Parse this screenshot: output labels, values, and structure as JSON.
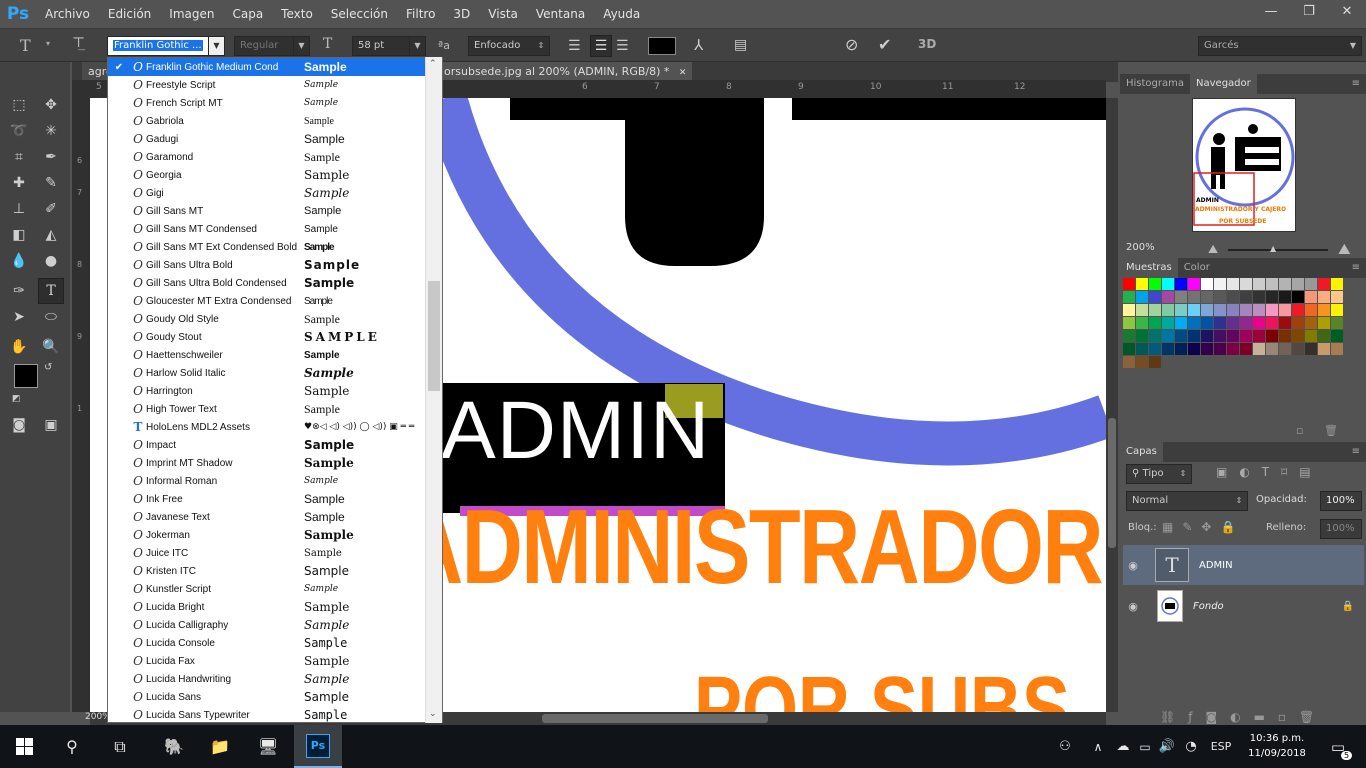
{
  "app": {
    "logo": "Ps"
  },
  "menu": [
    "Archivo",
    "Edición",
    "Imagen",
    "Capa",
    "Texto",
    "Selección",
    "Filtro",
    "3D",
    "Vista",
    "Ventana",
    "Ayuda"
  ],
  "window_controls": {
    "minimize": "—",
    "restore": "❐",
    "close": "✕"
  },
  "options": {
    "font_family": "Franklin Gothic ...",
    "font_style": "Regular",
    "font_size": "58 pt",
    "aa_label": "a",
    "antialias": "Enfocado",
    "three_d": "3D",
    "workspace": "Garcés"
  },
  "document_tabs": [
    {
      "label": "agre"
    },
    {
      "label": "orsubsede.jpg al 200% (ADMIN, RGB/8) *",
      "close": "✕"
    }
  ],
  "ruler_top_ticks": [
    "5",
    "6",
    "7",
    "8",
    "9",
    "10",
    "11",
    "12"
  ],
  "ruler_left_ticks": [
    "6",
    "7",
    "8",
    "9",
    "1"
  ],
  "canvas_text": {
    "admin": "ADMIN",
    "administrador": "ADMINISTRADOR",
    "por_subs": "POR SUBS"
  },
  "status": {
    "zoom": "200%"
  },
  "navigator": {
    "tabs": [
      "Histograma",
      "Navegador"
    ],
    "active_tab": "Navegador",
    "zoom": "200%",
    "thumb_admin": "ADMIN",
    "thumb_line1": "ADMINISTRADOR Y CAJERO",
    "thumb_line2": "POR SUBSEDE"
  },
  "swatches_panel": {
    "tabs": [
      "Muestras",
      "Color"
    ],
    "active_tab": "Muestras",
    "colors": [
      "#ff0000",
      "#ffff00",
      "#00ff00",
      "#00ffff",
      "#0000ff",
      "#ff00ff",
      "#ffffff",
      "#f2f2f2",
      "#e6e6e6",
      "#d9d9d9",
      "#cccccc",
      "#bfbfbf",
      "#b3b3b3",
      "#a6a6a6",
      "#999999",
      "#ed1c24",
      "#fff200",
      "#22b14c",
      "#00a2e8",
      "#3f48cc",
      "#a349a4",
      "#808080",
      "#737373",
      "#666666",
      "#595959",
      "#4d4d4d",
      "#404040",
      "#333333",
      "#262626",
      "#1a1a1a",
      "#000000",
      "#f7977a",
      "#fbad82",
      "#fdc68a",
      "#fff79a",
      "#c4df9b",
      "#a2d39c",
      "#82ca9d",
      "#7bcdc8",
      "#6ecff6",
      "#7ea7d8",
      "#8493ca",
      "#8882be",
      "#a187be",
      "#bc8dbf",
      "#f49ac2",
      "#f6989d",
      "#ed1c24",
      "#f26522",
      "#f7941d",
      "#fff200",
      "#8dc73f",
      "#39b54a",
      "#00a651",
      "#00a99d",
      "#00aeef",
      "#0072bc",
      "#0054a6",
      "#2e3192",
      "#662d91",
      "#92278f",
      "#ec008c",
      "#ed145b",
      "#9e0b0f",
      "#a0410d",
      "#a3620a",
      "#aba000",
      "#598527",
      "#1a7b30",
      "#007236",
      "#00746b",
      "#0076a3",
      "#004b80",
      "#003471",
      "#1b1464",
      "#440e62",
      "#630460",
      "#9e005d",
      "#9e0039",
      "#790000",
      "#7b2e00",
      "#7d4900",
      "#827b00",
      "#406618",
      "#005e20",
      "#005826",
      "#005952",
      "#005b7f",
      "#003663",
      "#002157",
      "#0d004c",
      "#32004b",
      "#4b0049",
      "#7b0046",
      "#7a0026",
      "#c7b299",
      "#998675",
      "#736357",
      "#534741",
      "#37302a",
      "#c69c6d",
      "#a67c52",
      "#8c6239",
      "#754c24",
      "#603913"
    ]
  },
  "layers_panel": {
    "tab": "Capas",
    "filter": "Tipo",
    "blend": "Normal",
    "opacity_label": "Opacidad:",
    "opacity": "100%",
    "lock_label": "Bloq.:",
    "fill_label": "Relleno:",
    "fill": "100%",
    "layers": [
      {
        "name": "ADMIN",
        "thumb": "T"
      },
      {
        "name": "Fondo",
        "thumb": ""
      }
    ]
  },
  "font_list": [
    {
      "name": "Franklin Gothic Medium Cond",
      "sample": "Sample",
      "selected": true
    },
    {
      "name": "Freestyle Script",
      "sample": "Sample"
    },
    {
      "name": "French Script MT",
      "sample": "Sample"
    },
    {
      "name": "Gabriola",
      "sample": "Sample"
    },
    {
      "name": "Gadugi",
      "sample": "Sample"
    },
    {
      "name": "Garamond",
      "sample": "Sample"
    },
    {
      "name": "Georgia",
      "sample": "Sample"
    },
    {
      "name": "Gigi",
      "sample": "Sample"
    },
    {
      "name": "Gill Sans MT",
      "sample": "Sample"
    },
    {
      "name": "Gill Sans MT Condensed",
      "sample": "Sample"
    },
    {
      "name": "Gill Sans MT Ext Condensed Bold",
      "sample": "Sample"
    },
    {
      "name": "Gill Sans Ultra Bold",
      "sample": "Sample"
    },
    {
      "name": "Gill Sans Ultra Bold Condensed",
      "sample": "Sample"
    },
    {
      "name": "Gloucester MT Extra Condensed",
      "sample": "Sample"
    },
    {
      "name": "Goudy Old Style",
      "sample": "Sample"
    },
    {
      "name": "Goudy Stout",
      "sample": "SAMPLE"
    },
    {
      "name": "Haettenschweiler",
      "sample": "Sample"
    },
    {
      "name": "Harlow Solid Italic",
      "sample": "Sample"
    },
    {
      "name": "Harrington",
      "sample": "Sample"
    },
    {
      "name": "High Tower Text",
      "sample": "Sample"
    },
    {
      "name": "HoloLens MDL2 Assets",
      "sample": "♥⊗◁ ◁) ◁)) ◯ ◁)) ▣ ═ ═"
    },
    {
      "name": "Impact",
      "sample": "Sample"
    },
    {
      "name": "Imprint MT Shadow",
      "sample": "Sample"
    },
    {
      "name": "Informal Roman",
      "sample": "Sample"
    },
    {
      "name": "Ink Free",
      "sample": "Sample"
    },
    {
      "name": "Javanese Text",
      "sample": "Sample"
    },
    {
      "name": "Jokerman",
      "sample": "Sample"
    },
    {
      "name": "Juice ITC",
      "sample": "Sample"
    },
    {
      "name": "Kristen ITC",
      "sample": "Sample"
    },
    {
      "name": "Kunstler Script",
      "sample": "Sample"
    },
    {
      "name": "Lucida Bright",
      "sample": "Sample"
    },
    {
      "name": "Lucida Calligraphy",
      "sample": "Sample"
    },
    {
      "name": "Lucida Console",
      "sample": "Sample"
    },
    {
      "name": "Lucida Fax",
      "sample": "Sample"
    },
    {
      "name": "Lucida Handwriting",
      "sample": "Sample"
    },
    {
      "name": "Lucida Sans",
      "sample": "Sample"
    },
    {
      "name": "Lucida Sans Typewriter",
      "sample": "Sample"
    }
  ],
  "taskbar": {
    "time": "10:36 p.m.",
    "date": "11/09/2018",
    "lang": "ESP",
    "notifications": "5"
  }
}
